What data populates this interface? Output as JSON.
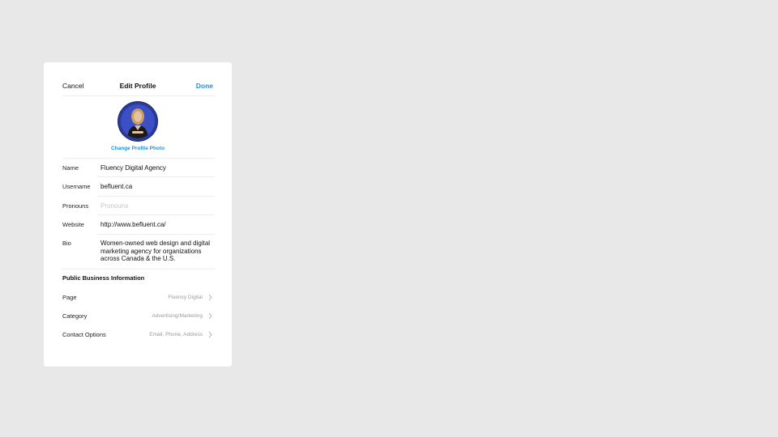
{
  "nav": {
    "cancel_label": "Cancel",
    "title": "Edit Profile",
    "done_label": "Done"
  },
  "profile": {
    "change_photo_label": "Change Profile Photo",
    "avatar_ring_color": "#2b3b9a"
  },
  "fields": {
    "name": {
      "label": "Name",
      "value": "Fluency Digital Agency"
    },
    "username": {
      "label": "Username",
      "value": "befluent.ca"
    },
    "pronouns": {
      "label": "Pronouns",
      "placeholder": "Pronouns"
    },
    "website": {
      "label": "Website",
      "value": "http://www.befluent.ca/"
    },
    "bio": {
      "label": "Bio",
      "value": "Women-owned web design and digital marketing agency for organizations across Canada & the U.S."
    }
  },
  "business": {
    "section_title": "Public Business Information",
    "rows": [
      {
        "label": "Page",
        "value": "Fluency Digital"
      },
      {
        "label": "Category",
        "value": "Advertising/Marketing"
      },
      {
        "label": "Contact Options",
        "value": "Email, Phone, Address"
      }
    ]
  },
  "colors": {
    "accent": "#2a8fd0",
    "background": "#e8e8e8",
    "card": "#ffffff"
  }
}
